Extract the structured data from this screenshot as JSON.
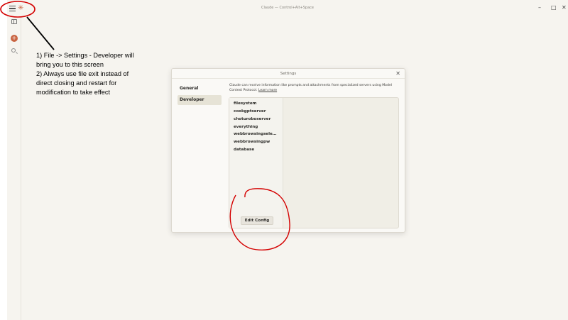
{
  "window": {
    "title": "Claude — Control+Alt+Space",
    "minimize_glyph": "–",
    "maximize_glyph": "□",
    "close_glyph": "✕"
  },
  "titlebar": {
    "menu_icon": "hamburger-icon",
    "star_icon": "claude-star-icon",
    "star_glyph": "✳"
  },
  "sidebar": {
    "new_chat_glyph": "+",
    "icons": [
      "sidebar-toggle-icon",
      "new-chat-icon",
      "search-icon"
    ]
  },
  "annotation": {
    "line1": "1) File -> Settings - Developer will bring you to this screen",
    "line2": "2) Always use file exit instead of direct closing and restart for modification to take effect",
    "color": "#d40000"
  },
  "settings": {
    "title": "Settings",
    "close_glyph": "✕",
    "nav": [
      {
        "label": "General",
        "active": false
      },
      {
        "label": "Developer",
        "active": true
      }
    ],
    "description": "Claude can receive information like prompts and attachments from specialized servers using Model Context Protocol.",
    "learn_more": "Learn more",
    "servers": [
      "filesystem",
      "cookgptserver",
      "choturoboserver",
      "everything",
      "webbrowsingseleni...",
      "webbrowsingpw",
      "database"
    ],
    "edit_config_label": "Edit Config"
  },
  "colors": {
    "accent": "#c96442",
    "background": "#f6f4ef",
    "dialog": "#faf9f6",
    "selected_nav": "#e6e3d6"
  }
}
